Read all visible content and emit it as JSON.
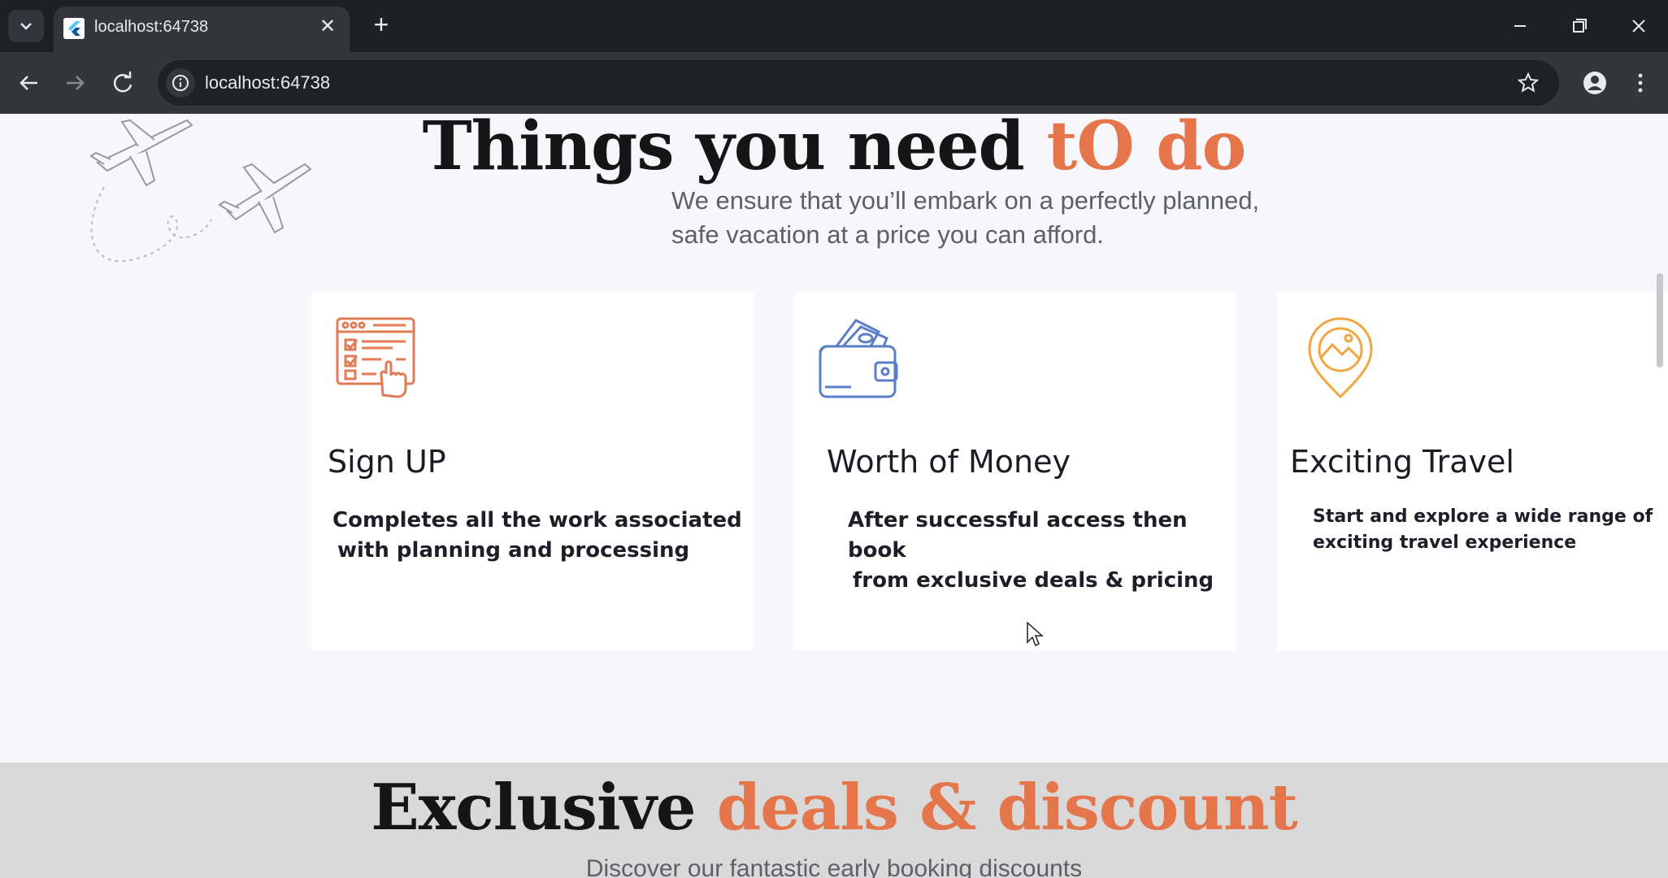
{
  "browser": {
    "tab_title": "localhost:64738",
    "url": "localhost:64738",
    "tab_close_glyph": "✕",
    "new_tab_glyph": "+"
  },
  "hero": {
    "heading_main": "Things you need ",
    "heading_accent": "tO do",
    "subtitle_line1": "We ensure that you’ll embark on a perfectly planned,",
    "subtitle_line2": "safe vacation at a price you can afford."
  },
  "cards": [
    {
      "icon": "checklist-click-icon",
      "icon_color": "#e07b56",
      "title": "Sign UP",
      "text_line1": "Completes all the work associated",
      "text_line2": "with planning and processing"
    },
    {
      "icon": "wallet-icon",
      "icon_color": "#5a7fc6",
      "title": "Worth of Money",
      "text_line1": "After successful access then book",
      "text_line2": "from exclusive deals & pricing"
    },
    {
      "icon": "location-pin-icon",
      "icon_color": "#f0a642",
      "title": "Exciting Travel",
      "text_line1": "Start and explore a wide range of",
      "text_line2": "exciting travel experience"
    }
  ],
  "deals": {
    "heading_main": "Exclusive ",
    "heading_accent": "deals & discount",
    "subtitle": "Discover our fantastic early booking discounts"
  },
  "colors": {
    "accent": "#e5754a",
    "chrome_dark": "#1f2023",
    "chrome_toolbar": "#35363a"
  }
}
